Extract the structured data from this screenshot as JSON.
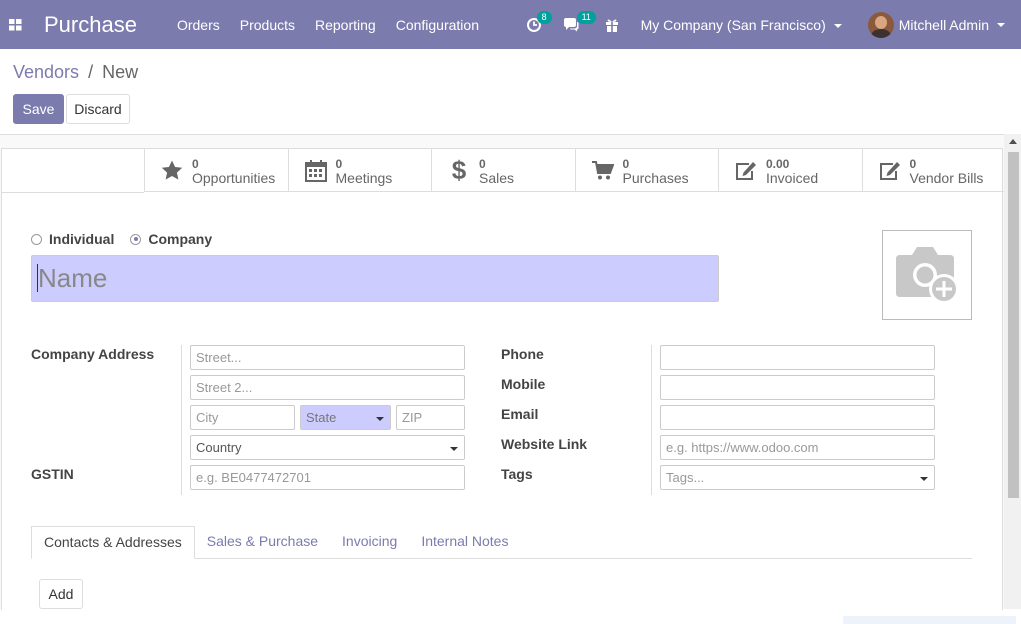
{
  "navbar": {
    "app_title": "Purchase",
    "menu": [
      "Orders",
      "Products",
      "Reporting",
      "Configuration"
    ],
    "activity_count": "8",
    "messages_count": "11",
    "company": "My Company (San Francisco)",
    "user": "Mitchell Admin",
    "color": "#7c7bad"
  },
  "breadcrumb": {
    "parent": "Vendors",
    "separator": "/",
    "current": "New"
  },
  "actions": {
    "save": "Save",
    "discard": "Discard"
  },
  "smart_buttons": [
    {
      "value": "0",
      "label": "Opportunities",
      "icon": "star-icon"
    },
    {
      "value": "0",
      "label": "Meetings",
      "icon": "calendar-icon"
    },
    {
      "value": "0",
      "label": "Sales",
      "icon": "dollar-icon"
    },
    {
      "value": "0",
      "label": "Purchases",
      "icon": "cart-icon"
    },
    {
      "value": "0.00",
      "label": "Invoiced",
      "icon": "pencil-square-icon"
    },
    {
      "value": "0",
      "label": "Vendor Bills",
      "icon": "pencil-square-icon"
    }
  ],
  "company_type": {
    "individual": "Individual",
    "company": "Company",
    "selected": "Company"
  },
  "name": {
    "placeholder": "Name"
  },
  "labels": {
    "company_address": "Company Address",
    "gstin": "GSTIN",
    "phone": "Phone",
    "mobile": "Mobile",
    "email": "Email",
    "website": "Website Link",
    "tags": "Tags"
  },
  "placeholders": {
    "street": "Street...",
    "street2": "Street 2...",
    "city": "City",
    "state": "State",
    "zip": "ZIP",
    "country": "Country",
    "gstin": "e.g. BE0477472701",
    "website": "e.g. https://www.odoo.com",
    "tags": "Tags..."
  },
  "tabs": [
    {
      "label": "Contacts & Addresses",
      "active": true
    },
    {
      "label": "Sales & Purchase",
      "active": false
    },
    {
      "label": "Invoicing",
      "active": false
    },
    {
      "label": "Internal Notes",
      "active": false
    }
  ],
  "add_label": "Add"
}
